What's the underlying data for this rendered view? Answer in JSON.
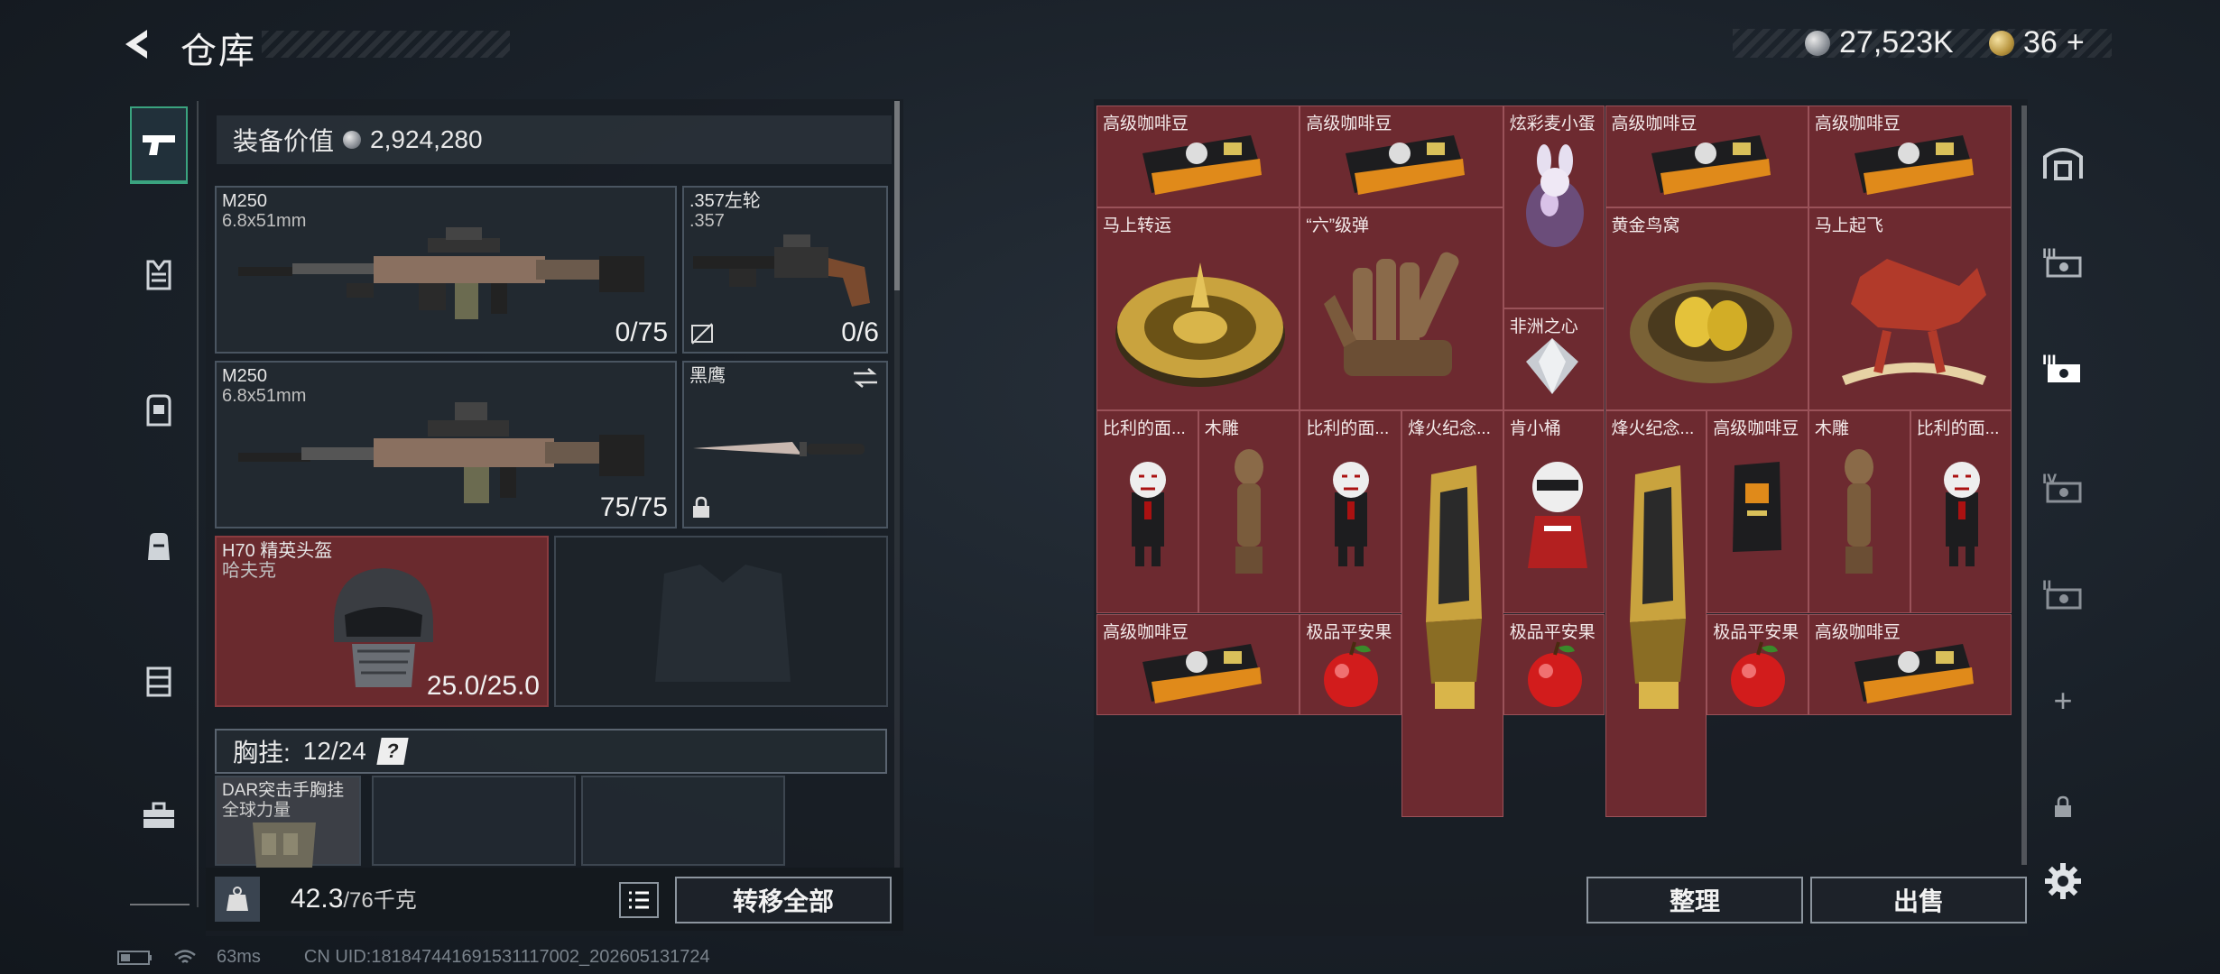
{
  "header": {
    "title": "仓库"
  },
  "currency": {
    "silver": "27,523K",
    "gold": "36",
    "gold_plus": "+"
  },
  "loadout": {
    "equip_value_label": "装备价值",
    "equip_value": "2,924,280",
    "slots": {
      "primary1": {
        "name": "M250",
        "caliber": "6.8x51mm",
        "ammo": "0/75"
      },
      "sidearm": {
        "name": ".357左轮",
        "caliber": ".357",
        "ammo": "0/6"
      },
      "primary2": {
        "name": "M250",
        "caliber": "6.8x51mm",
        "ammo": "75/75"
      },
      "melee": {
        "name": "黑鹰"
      },
      "helmet": {
        "name": "H70 精英头盔",
        "sub": "哈夫克",
        "durability": "25.0/25.0"
      }
    },
    "rig": {
      "label": "胸挂:",
      "capacity": "12/24",
      "item_name": "DAR突击手胸挂",
      "item_sub": "全球力量"
    },
    "weight": {
      "current": "42.3",
      "limit": "/76千克"
    },
    "transfer_all": "转移全部"
  },
  "storage": {
    "items": [
      {
        "name": "高级咖啡豆"
      },
      {
        "name": "高级咖啡豆"
      },
      {
        "name": "炫彩麦小蛋"
      },
      {
        "name": "高级咖啡豆"
      },
      {
        "name": "高级咖啡豆"
      },
      {
        "name": "马上转运"
      },
      {
        "name": "“六”级弹"
      },
      {
        "name": "非洲之心"
      },
      {
        "name": "黄金鸟窝"
      },
      {
        "name": "马上起飞"
      },
      {
        "name": "比利的面..."
      },
      {
        "name": "木雕"
      },
      {
        "name": "比利的面..."
      },
      {
        "name": "烽火纪念..."
      },
      {
        "name": "肯小桶"
      },
      {
        "name": "烽火纪念..."
      },
      {
        "name": "高级咖啡豆"
      },
      {
        "name": "木雕"
      },
      {
        "name": "比利的面..."
      },
      {
        "name": "高级咖啡豆"
      },
      {
        "name": "极品平安果"
      },
      {
        "name": "极品平安果"
      },
      {
        "name": "极品平安果"
      },
      {
        "name": "高级咖啡豆"
      }
    ],
    "sort_button": "整理",
    "sell_button": "出售"
  },
  "right_nav": {
    "plus": "+"
  },
  "footer": {
    "ping": "63ms",
    "uid": "CN UID:18184744169153111700​2_202605131724"
  },
  "colors": {
    "item_bg": "#6d2a30",
    "active_nav": "#3aa37f"
  }
}
